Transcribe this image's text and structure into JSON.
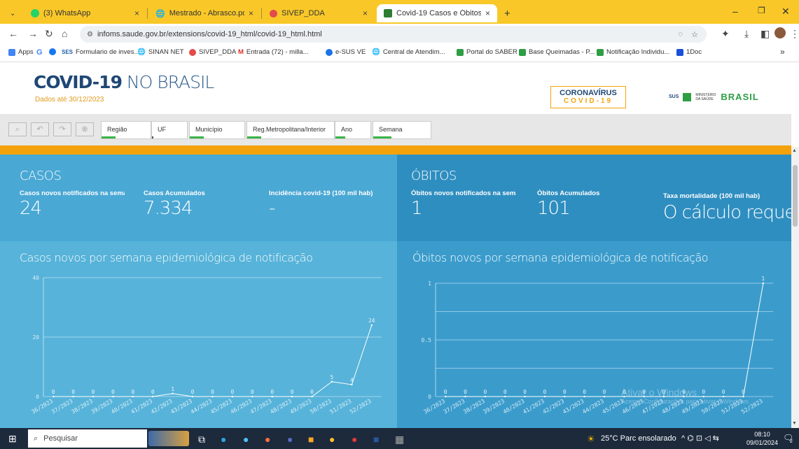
{
  "browser": {
    "tabs": [
      {
        "title": "(3) WhatsApp",
        "icon": "whatsapp-icon",
        "color": "#25d366",
        "active": false
      },
      {
        "title": "Mestrado - Abrasco.pdf",
        "icon": "pdf-icon",
        "color": "#555555",
        "active": false
      },
      {
        "title": "SIVEP_DDA",
        "icon": "sivep-icon",
        "color": "#e34b4b",
        "active": false
      },
      {
        "title": "Covid-19 Casos e Óbitos",
        "icon": "sus-icon",
        "color": "#2e7d32",
        "active": true
      }
    ],
    "new_tab": "+",
    "url": "infoms.saude.gov.br/extensions/covid-19_html/covid-19_html.html",
    "bookmarks": [
      {
        "label": "Apps",
        "icon": "apps-icon",
        "color": "#4285f4"
      },
      {
        "label": "",
        "icon": "google-icon",
        "color": "#4285f4"
      },
      {
        "label": "",
        "icon": "facebook-icon",
        "color": "#1877f2"
      },
      {
        "label": "Formulario de inves...",
        "icon": "ses-icon",
        "color": "#1f5fa8"
      },
      {
        "label": "SINAN NET",
        "icon": "globe-icon",
        "color": "#333333"
      },
      {
        "label": "SIVEP_DDA",
        "icon": "sivep-icon",
        "color": "#e34b4b"
      },
      {
        "label": "Entrada (72) - milla...",
        "icon": "gmail-icon",
        "color": "#d93025"
      },
      {
        "label": "e-SUS VE",
        "icon": "esus-icon",
        "color": "#1a73e8"
      },
      {
        "label": "Central de Atendim...",
        "icon": "globe-icon",
        "color": "#333333"
      },
      {
        "label": "Portal do SABER",
        "icon": "saber-icon",
        "color": "#2e9e44"
      },
      {
        "label": "Base Queimadas - P...",
        "icon": "sus-icon",
        "color": "#2e9e44"
      },
      {
        "label": "Notificação Individu...",
        "icon": "sus-icon",
        "color": "#2e9e44"
      },
      {
        "label": "1Doc",
        "icon": "doc-icon",
        "color": "#1a4fd8"
      }
    ],
    "more_bookmarks": "»"
  },
  "header": {
    "title_bold": "COVID-19",
    "title_light": "NO BRASIL",
    "subtitle": "Dados até 30/12/2023",
    "logo_line1": "CORONAVÍRUS",
    "logo_line2": "COVID-19",
    "gov_sus": "SUS",
    "gov_ministry": "MINISTÉRIO DA SAÚDE",
    "gov_brasil": "BRASIL"
  },
  "filters": [
    "Região",
    "UF",
    "Município",
    "Reg.Metropolitana/Interior",
    "Ano",
    "Semana"
  ],
  "casos": {
    "title": "CASOS",
    "kpis": [
      {
        "label": "Casos novos notificados na sema...",
        "value": "24"
      },
      {
        "label": "Casos Acumulados",
        "value": "7.334"
      },
      {
        "label": "Incidência covid-19 (100 mil hab)",
        "value": "-"
      }
    ],
    "chart_title": "Casos novos por semana epidemiológica de notificação"
  },
  "obitos": {
    "title": "ÓBITOS",
    "kpis": [
      {
        "label": "Óbitos novos notificados na sema...",
        "value": "1"
      },
      {
        "label": "Óbitos Acumulados",
        "value": "101"
      },
      {
        "label": "Taxa mortalidade (100 mil hab)",
        "value": "O cálculo reque"
      }
    ],
    "chart_title": "Óbitos novos por semana epidemiológica de notificação"
  },
  "chart_data": [
    {
      "type": "line",
      "x": [
        "36/2023",
        "37/2023",
        "38/2023",
        "39/2023",
        "40/2023",
        "41/2023",
        "42/2023",
        "43/2023",
        "44/2023",
        "45/2023",
        "46/2023",
        "47/2023",
        "48/2023",
        "49/2023",
        "50/2023",
        "51/2023",
        "52/2023"
      ],
      "values": [
        0,
        0,
        0,
        0,
        0,
        0,
        1,
        0,
        0,
        0,
        0,
        0,
        0,
        0,
        5,
        4,
        24
      ],
      "yticks": [
        0,
        20,
        40
      ],
      "ylim": [
        0,
        40
      ],
      "grid": true
    },
    {
      "type": "line",
      "x": [
        "36/2023",
        "37/2023",
        "38/2023",
        "39/2023",
        "40/2023",
        "41/2023",
        "42/2023",
        "43/2023",
        "44/2023",
        "45/2023",
        "46/2023",
        "47/2023",
        "48/2023",
        "49/2023",
        "50/2023",
        "51/2023",
        "52/2023"
      ],
      "values": [
        0,
        0,
        0,
        0,
        0,
        0,
        0,
        0,
        0,
        0,
        0,
        0,
        0,
        0,
        0,
        0,
        1
      ],
      "yticks": [
        0,
        0.5,
        1
      ],
      "ylim": [
        0,
        1
      ],
      "grid": true
    }
  ],
  "watermark": {
    "line1": "Ativar o Windows",
    "line2": "Acesse Configurações para ativar o Windows."
  },
  "taskbar": {
    "search_placeholder": "Pesquisar",
    "weather": "25°C Parc ensolarado",
    "time": "08:10",
    "date": "09/01/2024",
    "notifications": "2"
  },
  "colors": {
    "tabstrip": "#f9c828",
    "panel_left": "#57b3d9",
    "panel_left_dark": "#4aa8d4",
    "panel_right": "#3b9ccc",
    "panel_right_dark": "#2f8ec0",
    "orange": "#f4a20b"
  }
}
